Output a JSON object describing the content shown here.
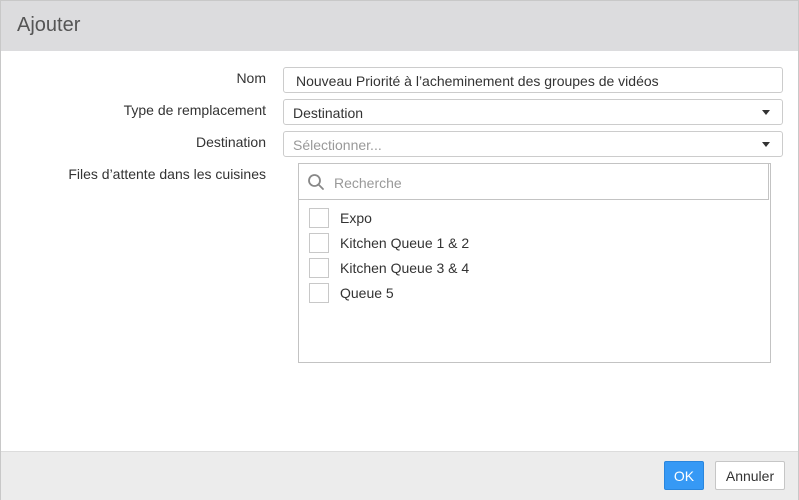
{
  "dialog": {
    "title": "Ajouter"
  },
  "form": {
    "name_label": "Nom",
    "name_value": "Nouveau Priorité à l’acheminement des groupes de vidéos",
    "replacement_type_label": "Type de remplacement",
    "replacement_type_value": "Destination",
    "destination_label": "Destination",
    "destination_placeholder": "Sélectionner...",
    "kitchen_queues_label": "Files d’attente dans les cuisines"
  },
  "queues": {
    "search_placeholder": "Recherche",
    "items": [
      {
        "label": "Expo",
        "checked": false
      },
      {
        "label": "Kitchen Queue 1 & 2",
        "checked": false
      },
      {
        "label": "Kitchen Queue 3 & 4",
        "checked": false
      },
      {
        "label": "Queue 5",
        "checked": false
      }
    ]
  },
  "footer": {
    "ok_label": "OK",
    "cancel_label": "Annuler"
  },
  "colors": {
    "primary": "#3699f5",
    "header_bg": "#dcdcde",
    "footer_bg": "#ececec"
  },
  "icons": {
    "search": "search-icon",
    "dropdown": "chevron-down-icon"
  }
}
